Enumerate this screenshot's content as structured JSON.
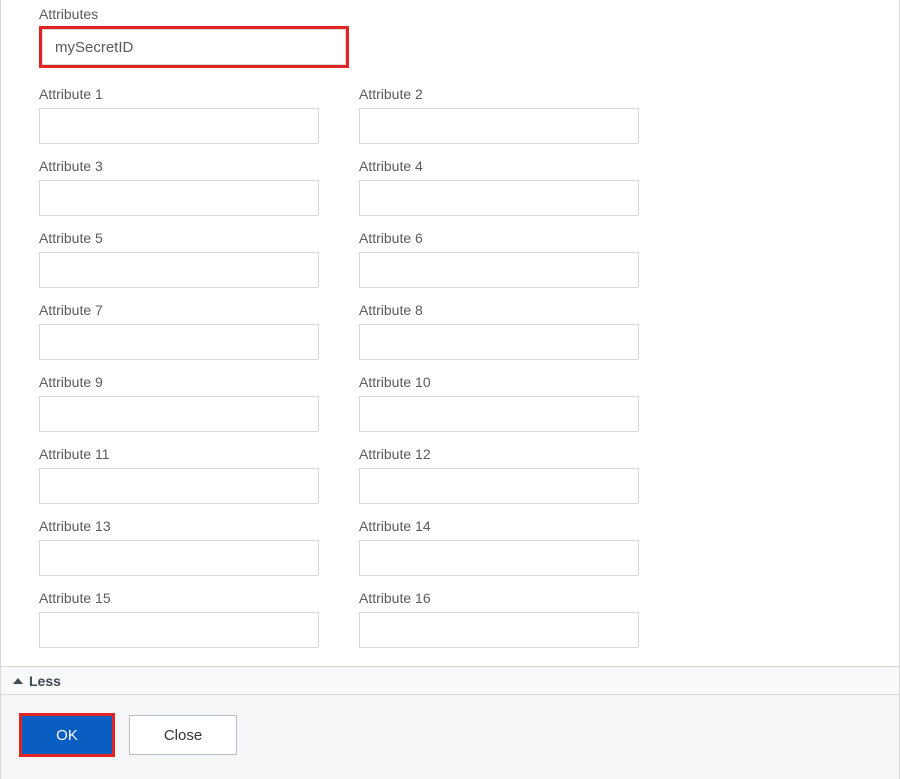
{
  "section_heading": "Attributes",
  "primary_value": "mySecretID",
  "attributes": [
    {
      "label": "Attribute 1",
      "value": ""
    },
    {
      "label": "Attribute 2",
      "value": ""
    },
    {
      "label": "Attribute 3",
      "value": ""
    },
    {
      "label": "Attribute 4",
      "value": ""
    },
    {
      "label": "Attribute 5",
      "value": ""
    },
    {
      "label": "Attribute 6",
      "value": ""
    },
    {
      "label": "Attribute 7",
      "value": ""
    },
    {
      "label": "Attribute 8",
      "value": ""
    },
    {
      "label": "Attribute 9",
      "value": ""
    },
    {
      "label": "Attribute 10",
      "value": ""
    },
    {
      "label": "Attribute 11",
      "value": ""
    },
    {
      "label": "Attribute 12",
      "value": ""
    },
    {
      "label": "Attribute 13",
      "value": ""
    },
    {
      "label": "Attribute 14",
      "value": ""
    },
    {
      "label": "Attribute 15",
      "value": ""
    },
    {
      "label": "Attribute 16",
      "value": ""
    }
  ],
  "collapse_label": "Less",
  "footer": {
    "ok_label": "OK",
    "close_label": "Close"
  },
  "colors": {
    "highlight": "#e02424",
    "primary_button": "#0a5ec2"
  }
}
